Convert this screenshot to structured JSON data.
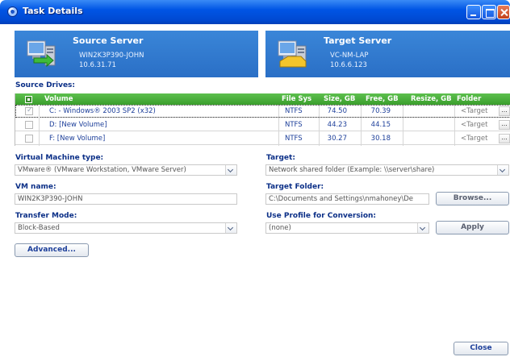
{
  "window": {
    "title": "Task Details"
  },
  "source_server": {
    "title": "Source Server",
    "hostname": "WIN2K3P390-JOHN",
    "ip": "10.6.31.71"
  },
  "target_server": {
    "title": "Target Server",
    "hostname": "VC-NM-LAP",
    "ip": "10.6.6.123"
  },
  "source_drives": {
    "label": "Source Drives:",
    "columns": [
      "Volume",
      "File Sys",
      "Size, GB",
      "Free, GB",
      "Resize, GB",
      "Folder"
    ],
    "rows": [
      {
        "volume": "C: - Windows® 2003 SP2 (x32)",
        "filesys": "NTFS",
        "size": "74.50",
        "free": "70.39",
        "resize": "",
        "folder": "<Target",
        "checked": true
      },
      {
        "volume": "D:  [New Volume]",
        "filesys": "NTFS",
        "size": "44.23",
        "free": "44.15",
        "resize": "",
        "folder": "<Target",
        "checked": false
      },
      {
        "volume": "F:  [New Volume]",
        "filesys": "NTFS",
        "size": "30.27",
        "free": "30.18",
        "resize": "",
        "folder": "<Target",
        "checked": false
      }
    ],
    "browse_glyph": "..."
  },
  "vm_type": {
    "label": "Virtual Machine type:",
    "value": "VMware® (VMware Workstation, VMware Server)"
  },
  "target": {
    "label": "Target:",
    "value": "Network shared folder (Example: \\\\server\\share)"
  },
  "vm_name": {
    "label": "VM name:",
    "value": "WIN2K3P390-JOHN"
  },
  "target_folder": {
    "label": "Target Folder:",
    "value": "C:\\Documents and Settings\\nmahoney\\De",
    "browse_label": "Browse..."
  },
  "transfer_mode": {
    "label": "Transfer Mode:",
    "value": "Block-Based"
  },
  "profile": {
    "label": "Use Profile for Conversion:",
    "value": "(none)",
    "apply_label": "Apply"
  },
  "advanced_label": "Advanced...",
  "close_label": "Close",
  "colors": {
    "titlebar": "#0055e5",
    "server_panel": "#2f7ad0",
    "table_header": "#4aad3c",
    "section_label": "#0b2f87"
  },
  "icons": [
    "window-icon",
    "minimize-icon",
    "maximize-icon",
    "close-icon",
    "source-server-icon",
    "target-server-icon",
    "dropdown-arrow-icon"
  ]
}
